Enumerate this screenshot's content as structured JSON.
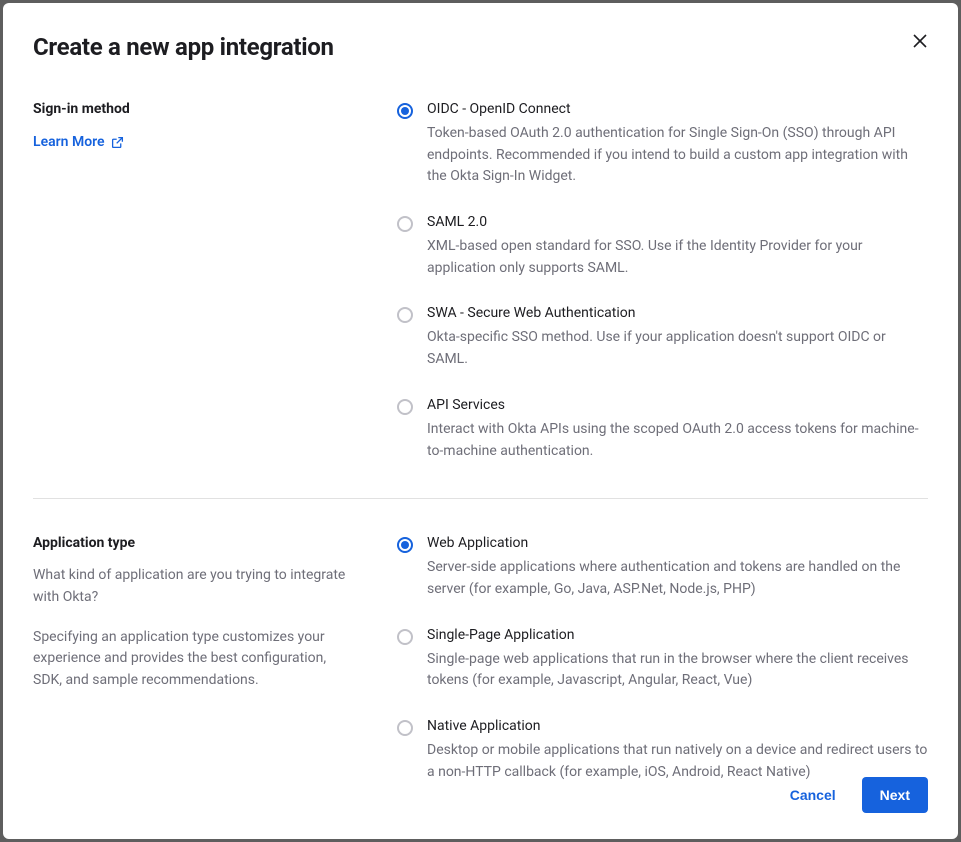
{
  "modal": {
    "title": "Create a new app integration"
  },
  "signInMethod": {
    "label": "Sign-in method",
    "learnMore": "Learn More",
    "options": [
      {
        "title": "OIDC - OpenID Connect",
        "desc": "Token-based OAuth 2.0 authentication for Single Sign-On (SSO) through API endpoints. Recommended if you intend to build a custom app integration with the Okta Sign-In Widget.",
        "selected": true
      },
      {
        "title": "SAML 2.0",
        "desc": "XML-based open standard for SSO. Use if the Identity Provider for your application only supports SAML.",
        "selected": false
      },
      {
        "title": "SWA - Secure Web Authentication",
        "desc": "Okta-specific SSO method. Use if your application doesn't support OIDC or SAML.",
        "selected": false
      },
      {
        "title": "API Services",
        "desc": "Interact with Okta APIs using the scoped OAuth 2.0 access tokens for machine-to-machine authentication.",
        "selected": false
      }
    ]
  },
  "applicationType": {
    "label": "Application type",
    "help1": "What kind of application are you trying to integrate with Okta?",
    "help2": "Specifying an application type customizes your experience and provides the best configuration, SDK, and sample recommendations.",
    "options": [
      {
        "title": "Web Application",
        "desc": "Server-side applications where authentication and tokens are handled on the server (for example, Go, Java, ASP.Net, Node.js, PHP)",
        "selected": true
      },
      {
        "title": "Single-Page Application",
        "desc": "Single-page web applications that run in the browser where the client receives tokens (for example, Javascript, Angular, React, Vue)",
        "selected": false
      },
      {
        "title": "Native Application",
        "desc": "Desktop or mobile applications that run natively on a device and redirect users to a non-HTTP callback (for example, iOS, Android, React Native)",
        "selected": false
      }
    ]
  },
  "footer": {
    "cancel": "Cancel",
    "next": "Next"
  }
}
